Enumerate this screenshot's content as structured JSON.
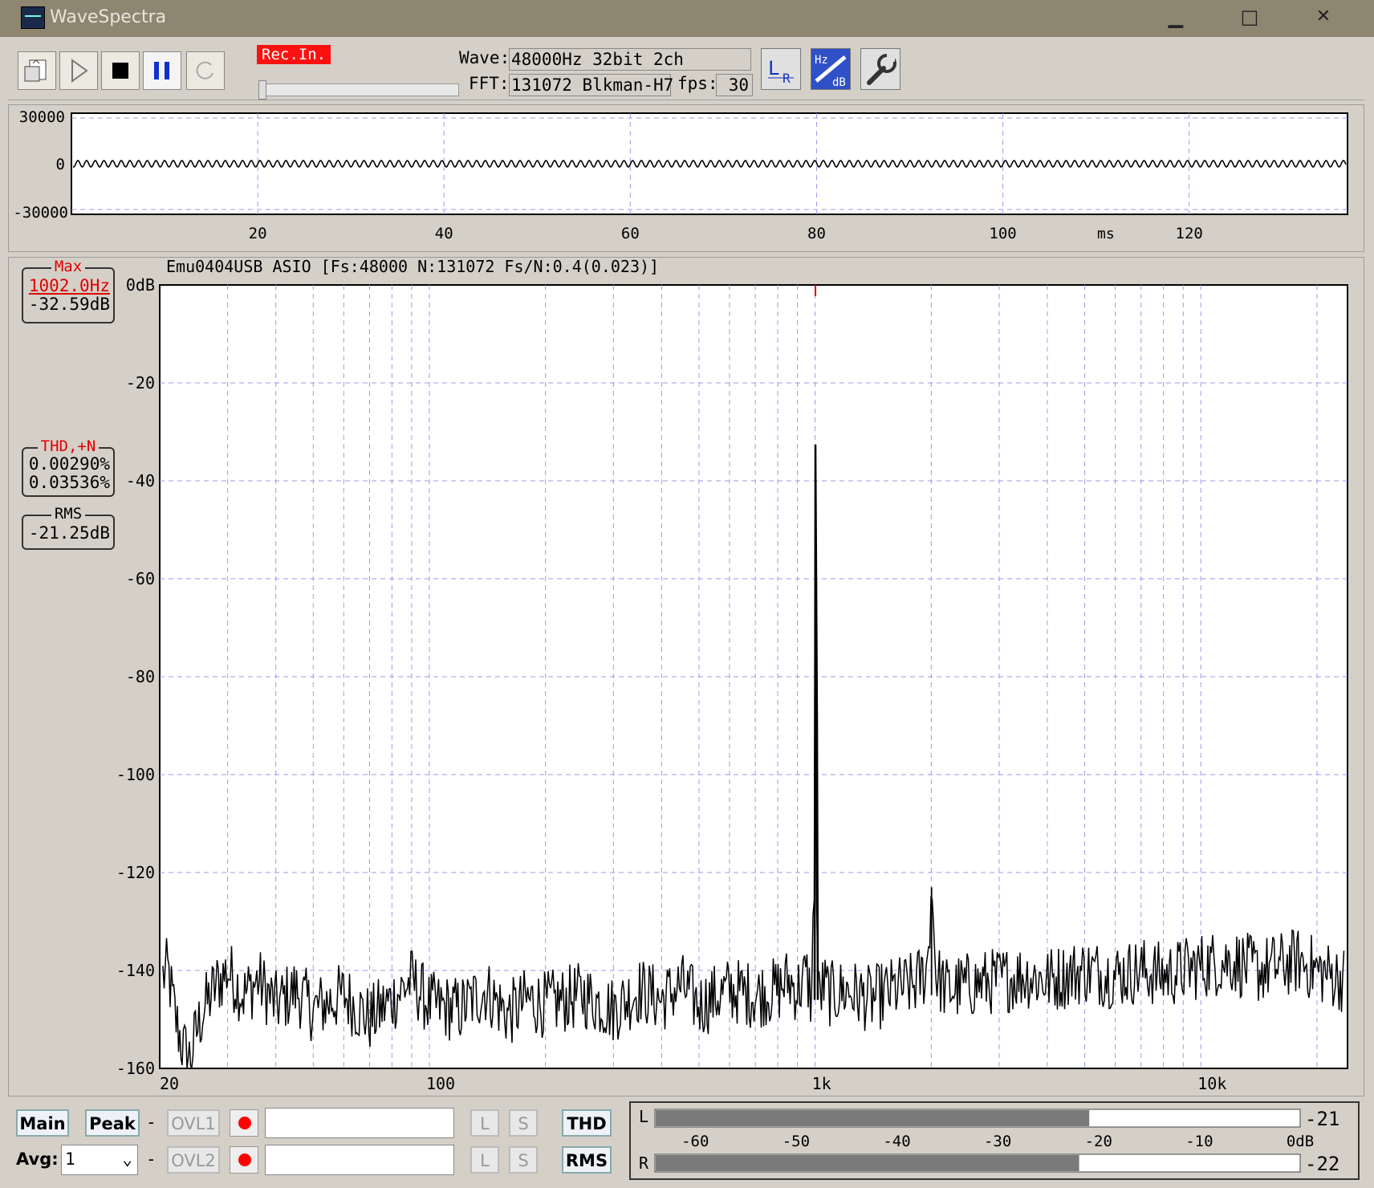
{
  "window": {
    "title": "WaveSpectra",
    "min_glyph": "▁",
    "max_glyph": "□",
    "close_glyph": "✕"
  },
  "toolbar": {
    "rec_label": "Rec.In.",
    "wave_label": "Wave:",
    "wave_value": "48000Hz 32bit 2ch",
    "fft_label": "FFT:",
    "fft_value": "131072 Blkman-H7",
    "fps_label": "fps:",
    "fps_value": "30",
    "lr_label_l": "L",
    "lr_label_r": "R",
    "hzdb_hz": "Hz",
    "hzdb_db": "dB"
  },
  "colors": {
    "plot_bg": "#ffffff",
    "grid": "#9a9aee",
    "trace": "#000000",
    "accent_red": "#e00000",
    "panel": "#d4d0c8",
    "titlebar": "#8e8671"
  },
  "wave_chart": {
    "y_labels": [
      "30000",
      "0",
      "-30000"
    ],
    "x_labels": [
      "20",
      "40",
      "60",
      "80",
      "100",
      "120"
    ],
    "x_unit": "ms"
  },
  "info_panel": {
    "max_label": "Max",
    "max_freq": "1002.0Hz",
    "max_level": "-32.59dB",
    "thd_label": "THD,+N",
    "thd_value": "0.00290%",
    "thdn_value": "0.03536%",
    "rms_label": "RMS",
    "rms_value": "-21.25dB"
  },
  "chart_data": {
    "type": "line",
    "title": "Emu0404USB ASIO   [Fs:48000 N:131072 Fs/N:0.4(0.023)]",
    "x_scale": "log",
    "xlim": [
      20,
      24000
    ],
    "ylim": [
      -160,
      0
    ],
    "x_tick_labels": [
      "20",
      "100",
      "1k",
      "10k"
    ],
    "y_tick_labels": [
      "0dB",
      "-20",
      "-40",
      "-60",
      "-80",
      "-100",
      "-120",
      "-140",
      "-160"
    ],
    "grid": true,
    "series": [
      {
        "x": [
          20,
          21,
          22,
          23,
          24,
          25,
          26,
          28,
          30,
          33,
          36,
          40,
          45,
          50,
          60,
          70,
          80,
          90,
          100,
          120,
          140,
          160,
          180,
          200,
          250,
          300,
          350,
          400,
          450,
          500,
          600,
          700,
          800,
          850,
          900,
          950,
          980,
          995,
          1002,
          1008,
          1020,
          1050,
          1100,
          1200,
          1400,
          1600,
          1800,
          1950,
          2004,
          2060,
          2200,
          2500,
          3000,
          3500,
          4000,
          5000,
          6000,
          7000,
          8000,
          9000,
          10000,
          12000,
          14000,
          16000,
          18000,
          20000,
          22000,
          24000
        ],
        "y": [
          -142,
          -140,
          -150,
          -156,
          -158,
          -152,
          -148,
          -143,
          -140,
          -145,
          -142,
          -147,
          -144,
          -148,
          -145,
          -150,
          -146,
          -142,
          -147,
          -148,
          -144,
          -149,
          -146,
          -147,
          -145,
          -148,
          -144,
          -146,
          -143,
          -147,
          -144,
          -145,
          -144,
          -142,
          -144,
          -141,
          -146,
          -120,
          -32.6,
          -125,
          -146,
          -143,
          -145,
          -144,
          -146,
          -144,
          -143,
          -140,
          -123,
          -141,
          -144,
          -143,
          -142,
          -141,
          -142,
          -140,
          -141,
          -140,
          -141,
          -140,
          -139,
          -138,
          -140,
          -139,
          -138,
          -140,
          -141,
          -142
        ]
      }
    ],
    "peak_marker": {
      "x": 1002,
      "y": -32.59
    }
  },
  "bottom": {
    "main_label": "Main",
    "peak_label": "Peak",
    "dash1": "-",
    "ovl1_label": "OVL1",
    "ovl2_label": "OVL2",
    "avg_label": "Avg:",
    "avg_value": "1",
    "dash2": "-",
    "l_label": "L",
    "s_label": "S",
    "thd_label": "THD",
    "rms_label": "RMS"
  },
  "level_meter": {
    "left_label": "L",
    "right_label": "R",
    "scale": [
      "-60",
      "-50",
      "-40",
      "-30",
      "-20",
      "-10",
      "0dB"
    ],
    "left_value": "-21",
    "right_value": "-22",
    "left_level_db": -21,
    "right_level_db": -22
  }
}
